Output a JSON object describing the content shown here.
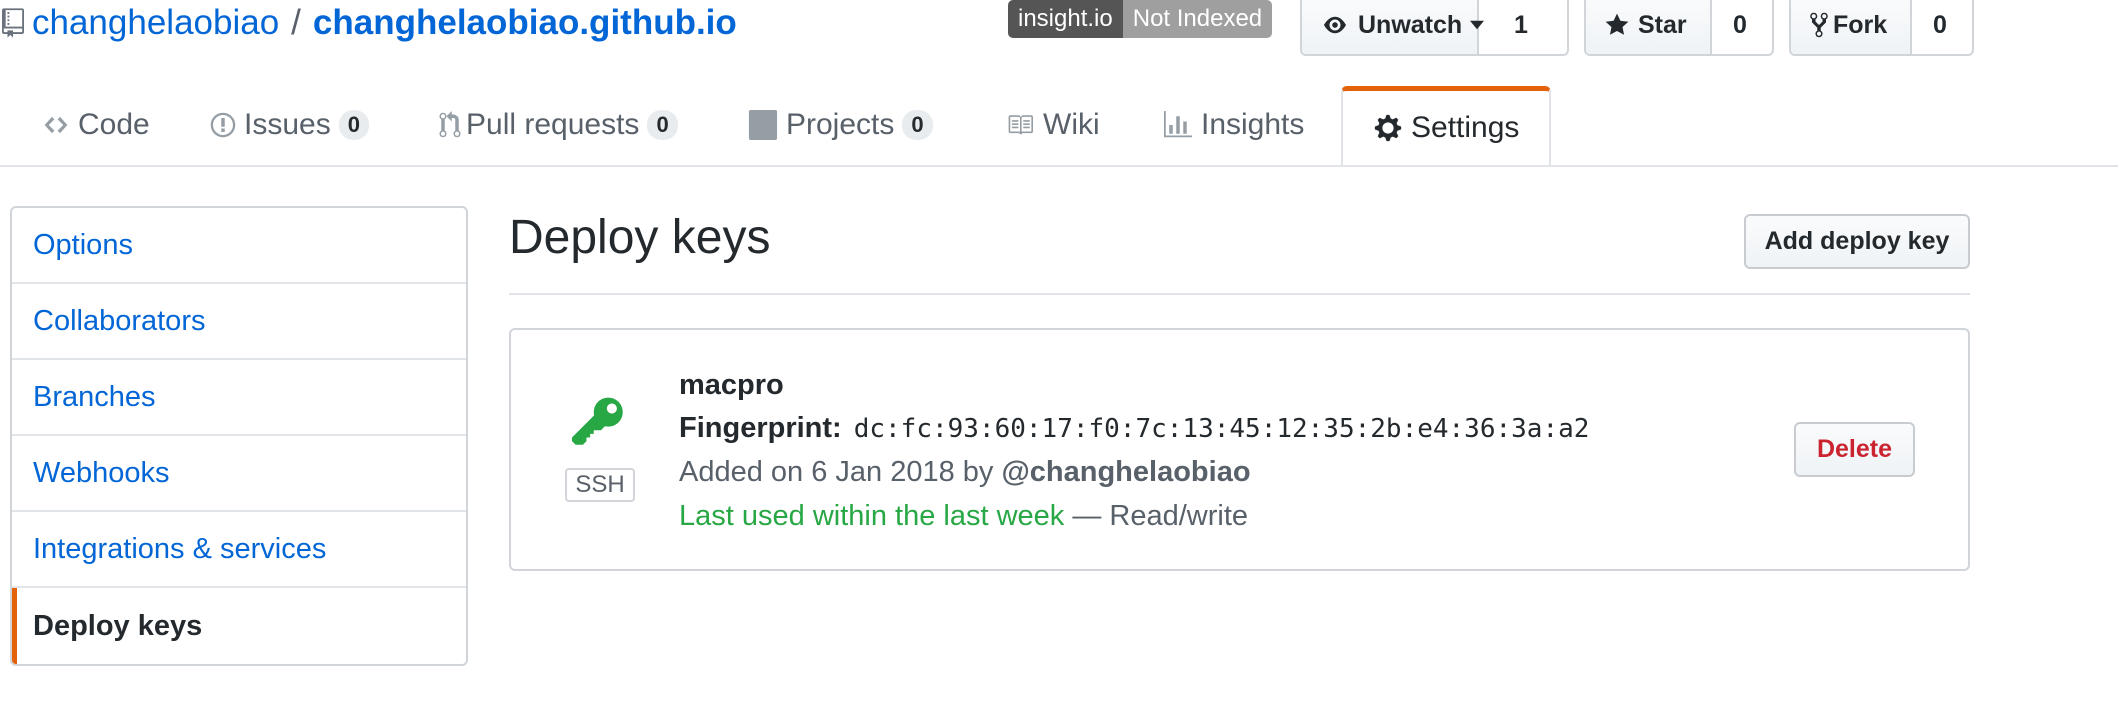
{
  "colors": {
    "link": "#0366d6",
    "accent_orange": "#e36209",
    "success_green": "#28a745",
    "danger_red": "#cb2431"
  },
  "repo": {
    "owner": "changhelaobiao",
    "separator": "/",
    "name": "changhelaobiao.github.io",
    "icon": "repo-icon"
  },
  "badge": {
    "left": "insight.io",
    "right": "Not Indexed"
  },
  "actions": {
    "watch": {
      "label": "Unwatch",
      "count": "1",
      "icon": "eye-icon"
    },
    "star": {
      "label": "Star",
      "count": "0",
      "icon": "star-icon"
    },
    "fork": {
      "label": "Fork",
      "count": "0",
      "icon": "fork-icon"
    }
  },
  "tabs": [
    {
      "label": "Code",
      "icon": "code-icon"
    },
    {
      "label": "Issues",
      "count": "0",
      "icon": "issue-icon"
    },
    {
      "label": "Pull requests",
      "count": "0",
      "icon": "pull-request-icon"
    },
    {
      "label": "Projects",
      "count": "0",
      "icon": "project-icon"
    },
    {
      "label": "Wiki",
      "icon": "book-icon"
    },
    {
      "label": "Insights",
      "icon": "graph-icon"
    },
    {
      "label": "Settings",
      "icon": "gear-icon",
      "selected": true
    }
  ],
  "sidebar": {
    "items": [
      {
        "label": "Options"
      },
      {
        "label": "Collaborators"
      },
      {
        "label": "Branches"
      },
      {
        "label": "Webhooks"
      },
      {
        "label": "Integrations & services"
      },
      {
        "label": "Deploy keys",
        "selected": true
      }
    ]
  },
  "main": {
    "title": "Deploy keys",
    "add_button": "Add deploy key",
    "key": {
      "icon": "key-icon",
      "type_label": "SSH",
      "title": "macpro",
      "fingerprint_label": "Fingerprint:",
      "fingerprint": "dc:fc:93:60:17:f0:7c:13:45:12:35:2b:e4:36:3a:a2",
      "added_prefix": "Added on 6 Jan 2018 by",
      "added_by": "@changhelaobiao",
      "last_used": "Last used within the last week",
      "access": "— Read/write",
      "delete_label": "Delete"
    }
  }
}
